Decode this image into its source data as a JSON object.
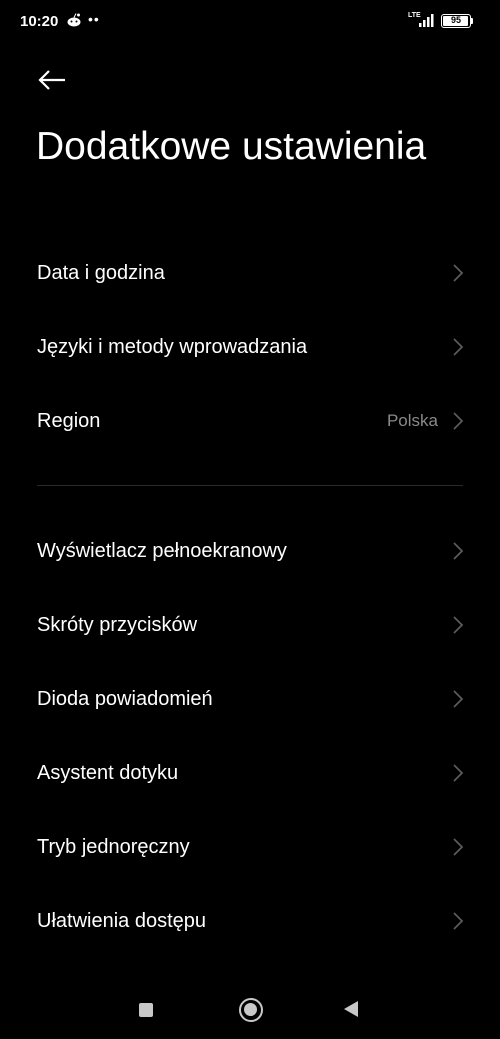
{
  "status_bar": {
    "time": "10:20",
    "dots": "••",
    "network": "LTE",
    "battery": "95",
    "battery_level": 0.95,
    "notification_icon": "reddit-icon"
  },
  "header": {
    "back_icon": "arrow-left-icon",
    "title": "Dodatkowe ustawienia"
  },
  "groups": [
    {
      "items": [
        {
          "label": "Data i godzina",
          "value": ""
        },
        {
          "label": "Języki i metody wprowadzania",
          "value": ""
        },
        {
          "label": "Region",
          "value": "Polska"
        }
      ]
    },
    {
      "items": [
        {
          "label": "Wyświetlacz pełnoekranowy",
          "value": ""
        },
        {
          "label": "Skróty przycisków",
          "value": ""
        },
        {
          "label": "Dioda powiadomień",
          "value": ""
        },
        {
          "label": "Asystent dotyku",
          "value": ""
        },
        {
          "label": "Tryb jednoręczny",
          "value": ""
        },
        {
          "label": "Ułatwienia dostępu",
          "value": ""
        }
      ]
    }
  ],
  "nav_bar": {
    "icons": [
      "square-recents-icon",
      "circle-home-icon",
      "triangle-back-icon"
    ]
  },
  "colors": {
    "background": "#000000",
    "text": "#ffffff",
    "secondary_text": "#8a8a8a",
    "chevron": "#5a5a5a",
    "divider": "#2a2a2a"
  }
}
